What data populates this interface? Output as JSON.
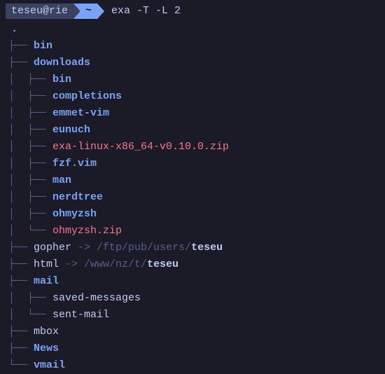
{
  "prompt": {
    "user_host": "teseu@rie",
    "dir": "~",
    "command": "exa -T -L 2"
  },
  "root": ".",
  "rows": [
    {
      "prefix": "├── ",
      "name": "bin",
      "style": "dir"
    },
    {
      "prefix": "├── ",
      "name": "downloads",
      "style": "dir"
    },
    {
      "prefix": "│  ├── ",
      "name": "bin",
      "style": "dir"
    },
    {
      "prefix": "│  ├── ",
      "name": "completions",
      "style": "dir"
    },
    {
      "prefix": "│  ├── ",
      "name": "emmet-vim",
      "style": "dir"
    },
    {
      "prefix": "│  ├── ",
      "name": "eunuch",
      "style": "dir"
    },
    {
      "prefix": "│  ├── ",
      "name": "exa-linux-x86_64-v0.10.0.zip",
      "style": "file"
    },
    {
      "prefix": "│  ├── ",
      "name": "fzf.vim",
      "style": "dir"
    },
    {
      "prefix": "│  ├── ",
      "name": "man",
      "style": "dir"
    },
    {
      "prefix": "│  ├── ",
      "name": "nerdtree",
      "style": "dir"
    },
    {
      "prefix": "│  ├── ",
      "name": "ohmyzsh",
      "style": "dir"
    },
    {
      "prefix": "│  └── ",
      "name": "ohmyzsh.zip",
      "style": "file"
    },
    {
      "prefix": "├── ",
      "name": "gopher",
      "style": "plain",
      "link": {
        "arrow": " -> ",
        "path": "/ftp/pub/users/",
        "target": "teseu"
      }
    },
    {
      "prefix": "├── ",
      "name": "html",
      "style": "plain",
      "link": {
        "arrow": " -> ",
        "path": "/www/nz/t/",
        "target": "teseu"
      }
    },
    {
      "prefix": "├── ",
      "name": "mail",
      "style": "dir"
    },
    {
      "prefix": "│  ├── ",
      "name": "saved-messages",
      "style": "plain"
    },
    {
      "prefix": "│  └── ",
      "name": "sent-mail",
      "style": "plain"
    },
    {
      "prefix": "├── ",
      "name": "mbox",
      "style": "plain"
    },
    {
      "prefix": "├── ",
      "name": "News",
      "style": "dir"
    },
    {
      "prefix": "└── ",
      "name": "vmail",
      "style": "dir"
    }
  ]
}
